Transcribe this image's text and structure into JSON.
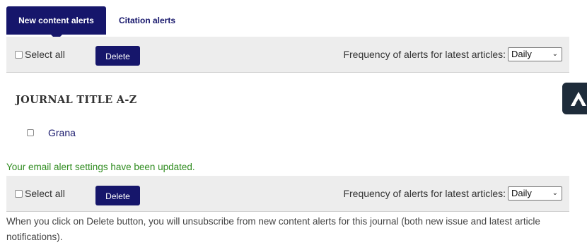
{
  "tabs": [
    {
      "label": "New content alerts",
      "active": true
    },
    {
      "label": "Citation alerts",
      "active": false
    }
  ],
  "toolbar": {
    "select_all_label": "Select all",
    "delete_label": "Delete",
    "frequency_label": "Frequency of alerts for latest articles:",
    "frequency_value": "Daily"
  },
  "journal_section": {
    "title": "JOURNAL TITLE A-Z",
    "journals": [
      {
        "name": "Grana"
      }
    ]
  },
  "status_message": "Your email alert settings have been updated.",
  "info_text": "When you click on Delete button, you will unsubscribe from new content alerts for this journal (both new issue and latest article notifications).",
  "colors": {
    "brand": "#16166b",
    "success": "#2e8b1e",
    "toolbar_bg": "#ededed"
  },
  "floating_button": {
    "icon": "accessibility-logo-icon"
  }
}
